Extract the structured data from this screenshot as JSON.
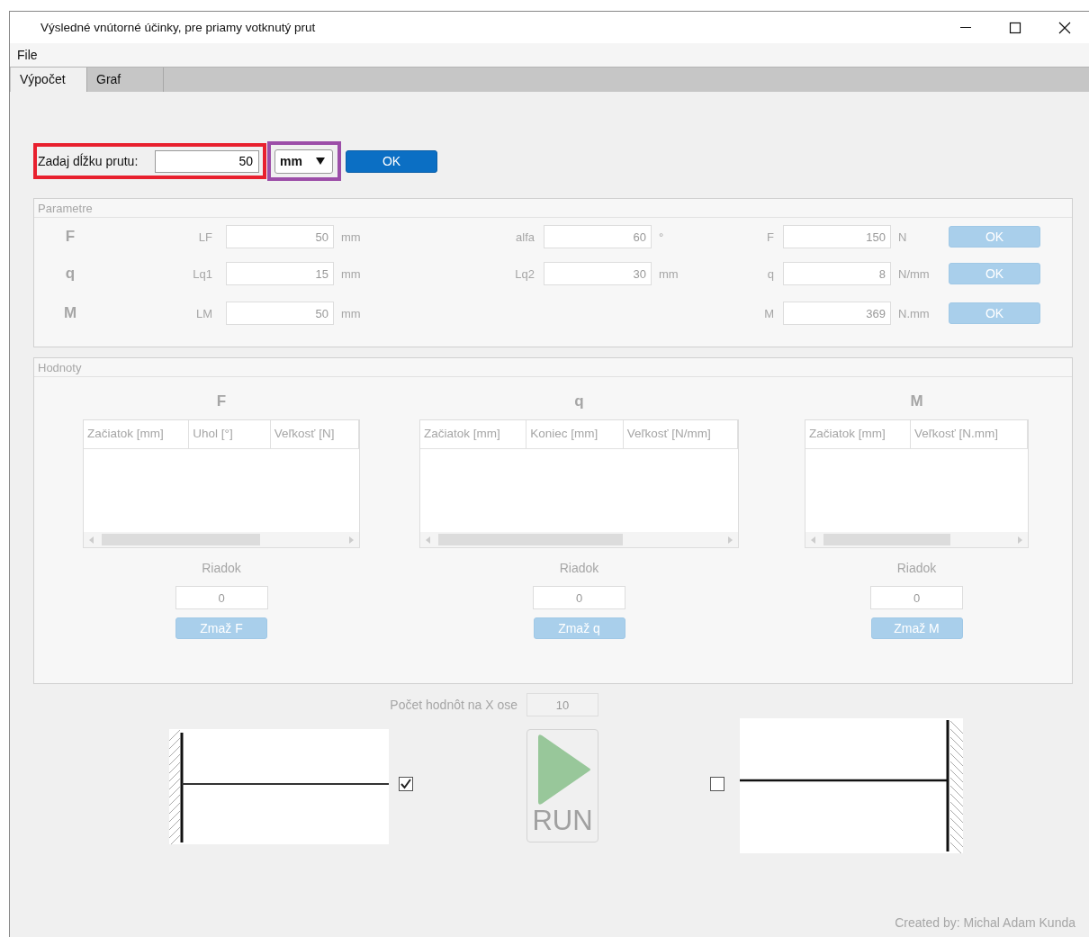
{
  "window": {
    "title": "Výsledné vnútorné účinky, pre priamy votknutý prut"
  },
  "menu": [
    "File"
  ],
  "tabs": [
    {
      "label": "Výpočet",
      "selected": true
    },
    {
      "label": "Graf",
      "selected": false
    }
  ],
  "length_row": {
    "label": "Zadaj dĺžku prutu:",
    "value": "50",
    "unit": "mm",
    "ok": "OK"
  },
  "parameters": {
    "title": "Parametre",
    "disabled": true,
    "rows": [
      {
        "symbol": "F",
        "fields": [
          {
            "kind": "position",
            "label": "LF",
            "value": "50",
            "unit": "mm"
          },
          {
            "kind": "secondary",
            "label": "alfa",
            "value": "60",
            "unit": "°"
          },
          {
            "kind": "magnitude",
            "label": "F",
            "value": "150",
            "unit": "N"
          }
        ],
        "button": "OK"
      },
      {
        "symbol": "q",
        "fields": [
          {
            "kind": "position",
            "label": "Lq1",
            "value": "15",
            "unit": "mm"
          },
          {
            "kind": "secondary",
            "label": "Lq2",
            "value": "30",
            "unit": "mm"
          },
          {
            "kind": "magnitude",
            "label": "q",
            "value": "8",
            "unit": "N/mm"
          }
        ],
        "button": "OK"
      },
      {
        "symbol": "M",
        "fields": [
          {
            "kind": "position",
            "label": "LM",
            "value": "50",
            "unit": "mm"
          },
          {
            "kind": "magnitude",
            "label": "M",
            "value": "369",
            "unit": "N.mm"
          }
        ],
        "button": "OK"
      }
    ]
  },
  "values": {
    "title": "Hodnoty",
    "disabled": true,
    "groups": [
      {
        "title": "F",
        "columns": [
          "Začiatok [mm]",
          "Uhol [°]",
          "Veľkosť [N]"
        ],
        "row_label": "Riadok",
        "row_value": "0",
        "delete": "Zmaž F"
      },
      {
        "title": "q",
        "columns": [
          "Začiatok [mm]",
          "Koniec [mm]",
          "Veľkosť [N/mm]"
        ],
        "row_label": "Riadok",
        "row_value": "0",
        "delete": "Zmaž q"
      },
      {
        "title": "M",
        "columns": [
          "Začiatok [mm]",
          "Veľkosť [N.mm]"
        ],
        "row_label": "Riadok",
        "row_value": "0",
        "delete": "Zmaž M"
      }
    ]
  },
  "x_count": {
    "label": "Počet hodnôt na X ose",
    "value": "10",
    "disabled": true
  },
  "left_support": {
    "checked": true
  },
  "run": {
    "label": "RUN",
    "disabled": true
  },
  "right_support": {
    "checked": false
  },
  "footer": "Created by: Michal Adam Kunda"
}
